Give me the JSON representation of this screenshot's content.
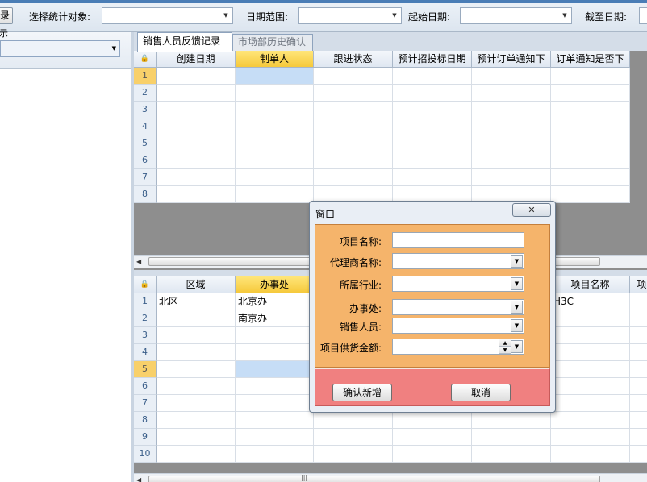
{
  "toolbar": {
    "left_button_label": "录",
    "target_label": "选择统计对象:",
    "target_value": "",
    "date_range_label": "日期范围:",
    "date_range_value": "",
    "start_date_label": "起始日期:",
    "start_date_value": "",
    "end_date_label": "截至日期:"
  },
  "left_panel": {
    "title": "提示",
    "combo_value": ""
  },
  "tabs": [
    {
      "label": "销售人员反馈记录",
      "active": true
    },
    {
      "label": "市场部历史确认",
      "active": false
    }
  ],
  "top_grid": {
    "columns": [
      "创建日期",
      "制单人",
      "跟进状态",
      "预计招投标日期",
      "预计订单通知下",
      "订单通知是否下"
    ],
    "row_numbers": [
      "1",
      "2",
      "3",
      "4",
      "5",
      "6",
      "7",
      "8"
    ],
    "current_row": "1",
    "selected_column": "制单人"
  },
  "bottom_grid": {
    "columns": [
      "区域",
      "办事处",
      "",
      "",
      "",
      "项目名称",
      "项"
    ],
    "row_numbers": [
      "1",
      "2",
      "3",
      "4",
      "5",
      "6",
      "7",
      "8",
      "9",
      "10"
    ],
    "rows": [
      [
        "北区",
        "北京办",
        "",
        "",
        "",
        "H3C",
        ""
      ],
      [
        "",
        "南京办",
        "",
        "",
        "",
        "",
        ""
      ]
    ],
    "current_row": "5",
    "selected_column": "办事处"
  },
  "dialog": {
    "title": "窗口",
    "close_icon": "✕",
    "fields": {
      "project_name": {
        "label": "项目名称:",
        "value": ""
      },
      "agent_name": {
        "label": "代理商名称:",
        "value": ""
      },
      "industry": {
        "label": "所属行业:",
        "value": ""
      },
      "office": {
        "label": "办事处:",
        "value": ""
      },
      "sales_person": {
        "label": "销售人员:",
        "value": ""
      },
      "supply_amount": {
        "label": "项目供货金额:",
        "value": ""
      }
    },
    "confirm_label": "确认新增",
    "cancel_label": "取消",
    "colors": {
      "form_bg": "#f5b46b",
      "button_bg": "#f08080"
    }
  }
}
